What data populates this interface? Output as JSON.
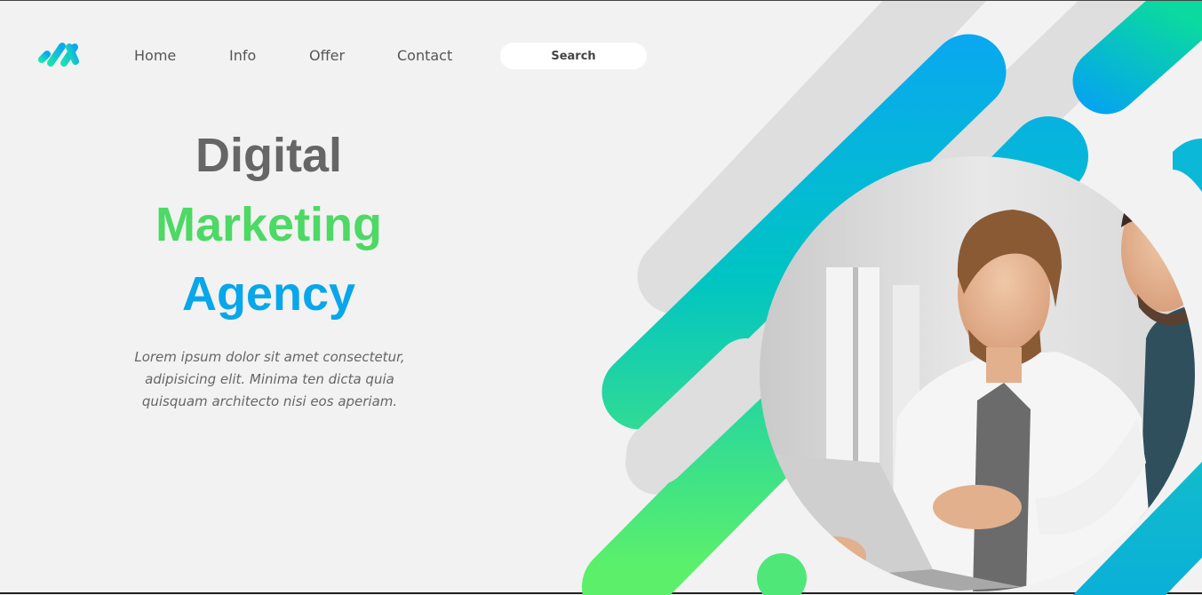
{
  "nav": {
    "items": [
      {
        "label": "Home"
      },
      {
        "label": "Info"
      },
      {
        "label": "Offer"
      },
      {
        "label": "Contact"
      }
    ],
    "search_placeholder": "Search"
  },
  "hero": {
    "line1": "Digital",
    "line2": "Marketing",
    "line3": "Agency",
    "description": "Lorem ipsum dolor sit amet consectetur, adipisicing elit. Minima ten dicta quia quisquam architecto nisi eos aperiam."
  },
  "colors": {
    "title_gray": "#666666",
    "title_green": "#4cd964",
    "title_blue": "#08a6ea",
    "gradient_blue": "#0aa8f0",
    "gradient_green": "#5cf06a"
  }
}
